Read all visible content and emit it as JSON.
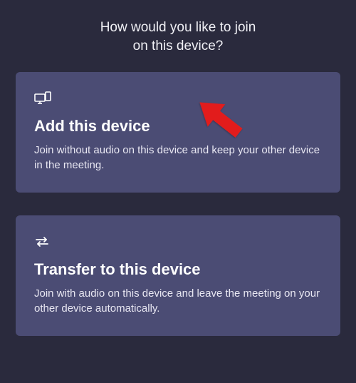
{
  "header": {
    "line1": "How would you like to join",
    "line2": "on this device?"
  },
  "cards": [
    {
      "title": "Add this device",
      "description": "Join without audio on this device and keep your other device in the meeting."
    },
    {
      "title": "Transfer to this device",
      "description": "Join with audio on this device and leave the meeting on your other device automatically."
    }
  ]
}
